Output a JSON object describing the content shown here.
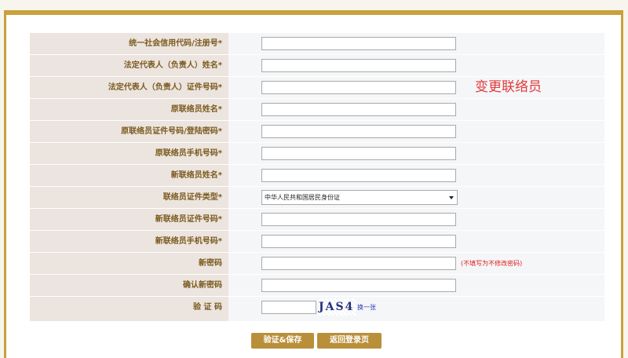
{
  "form": {
    "rows": [
      {
        "label": "统一社会信用代码/注册号*",
        "value": ""
      },
      {
        "label": "法定代表人（负责人）姓名*",
        "value": ""
      },
      {
        "label": "法定代表人（负责人）证件号码*",
        "value": ""
      },
      {
        "label": "原联络员姓名*",
        "value": ""
      },
      {
        "label": "原联络员证件号码/登陆密码*",
        "value": ""
      },
      {
        "label": "原联络员手机号码*",
        "value": ""
      },
      {
        "label": "新联络员姓名*",
        "value": ""
      },
      {
        "label": "联络员证件类型*",
        "selected": "中华人民共和国居民身份证"
      },
      {
        "label": "新联络员证件号码*",
        "value": ""
      },
      {
        "label": "新联络员手机号码*",
        "value": ""
      },
      {
        "label": "新密码",
        "value": "",
        "hint": "(不填写为不修改密码)"
      },
      {
        "label": "确认新密码",
        "value": ""
      },
      {
        "label": "验 证 码",
        "value": "",
        "captcha_text": "JAS4",
        "refresh_label": "换一张"
      }
    ]
  },
  "side_title": "变更联络员",
  "buttons": {
    "submit": "验证&保存",
    "back": "返回登录页"
  },
  "colors": {
    "accent": "#c9a03b",
    "button": "#b98f3a",
    "label_bg": "#ece4de",
    "label_text": "#7a5a1e",
    "hint": "#e02020"
  }
}
